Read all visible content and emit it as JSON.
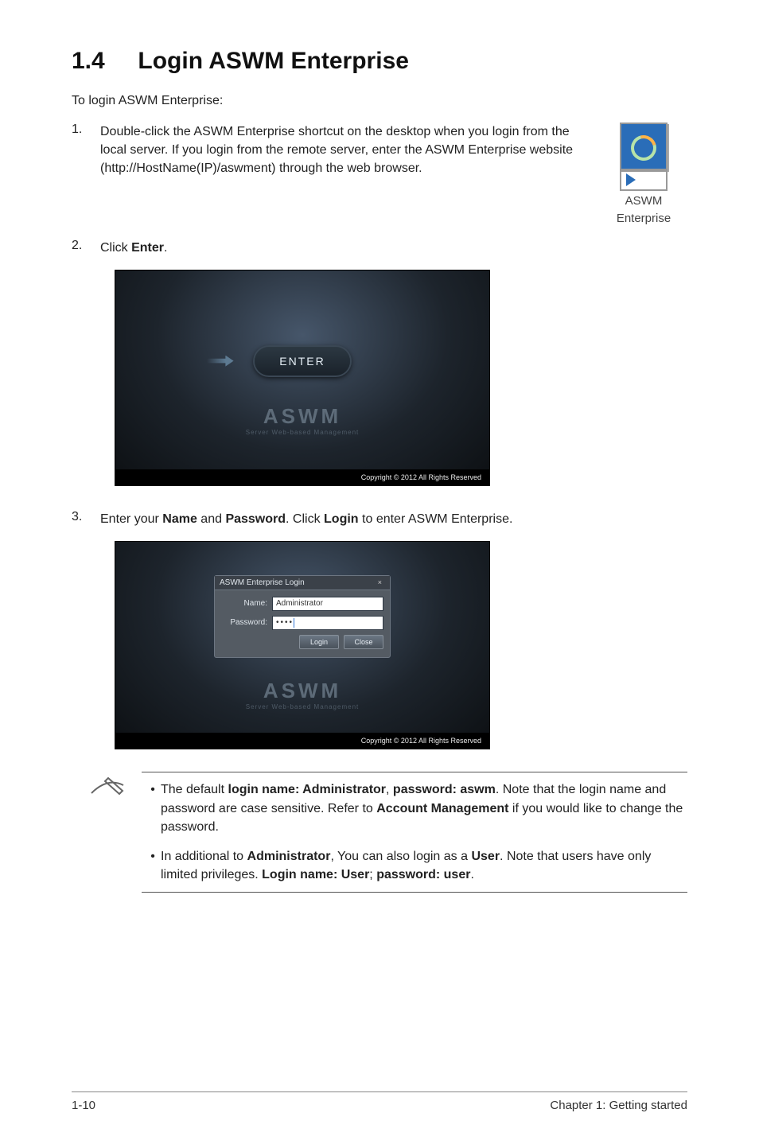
{
  "title": "1.4     Login ASWM Enterprise",
  "intro": "To login ASWM Enterprise:",
  "steps": {
    "s1_num": "1.",
    "s1_text_parts": {
      "a": "Double-click the ASWM Enterprise shortcut on the desktop when you login from the local server. If you login from the remote server, enter the ASWM Enterprise website (http://HostName(IP)/aswment) through the web browser."
    },
    "s2_num": "2.",
    "s2_a": "Click ",
    "s2_b": "Enter",
    "s2_c": ".",
    "s3_num": "3.",
    "s3_a": "Enter your ",
    "s3_b": "Name",
    "s3_c": " and ",
    "s3_d": "Password",
    "s3_e": ". Click ",
    "s3_f": "Login",
    "s3_g": " to enter ASWM Enterprise."
  },
  "icon": {
    "label_line1": "ASWM",
    "label_line2": "Enterprise"
  },
  "enter_screenshot": {
    "button": "ENTER",
    "logo_big": "ASWM",
    "logo_sub": "Server Web-based Management",
    "copyright": "Copyright © 2012 All Rights Reserved"
  },
  "login_screenshot": {
    "dialog_title": "ASWM Enterprise Login",
    "close_x": "×",
    "name_label": "Name:",
    "name_value": "Administrator",
    "password_label": "Password:",
    "password_value": "••••",
    "login_btn": "Login",
    "close_btn": "Close",
    "logo_big": "ASWM",
    "logo_sub": "Server Web-based Management",
    "copyright": "Copyright © 2012 All Rights Reserved"
  },
  "notes": {
    "n1": {
      "a": "The default ",
      "b": "login name: Administrator",
      "c": ", ",
      "d": "password: aswm",
      "e": ". Note that the login name and password are case sensitive. Refer to ",
      "f": "Account Management",
      "g": " if you would like to change the password."
    },
    "n2": {
      "a": "In additional to ",
      "b": "Administrator",
      "c": ", You can also login as a ",
      "d": "User",
      "e": ". Note that users have only limited privileges. ",
      "f": "Login name: User",
      "g": "; ",
      "h": "password: user",
      "i": "."
    }
  },
  "footer": {
    "left": "1-10",
    "right": "Chapter 1: Getting started"
  }
}
